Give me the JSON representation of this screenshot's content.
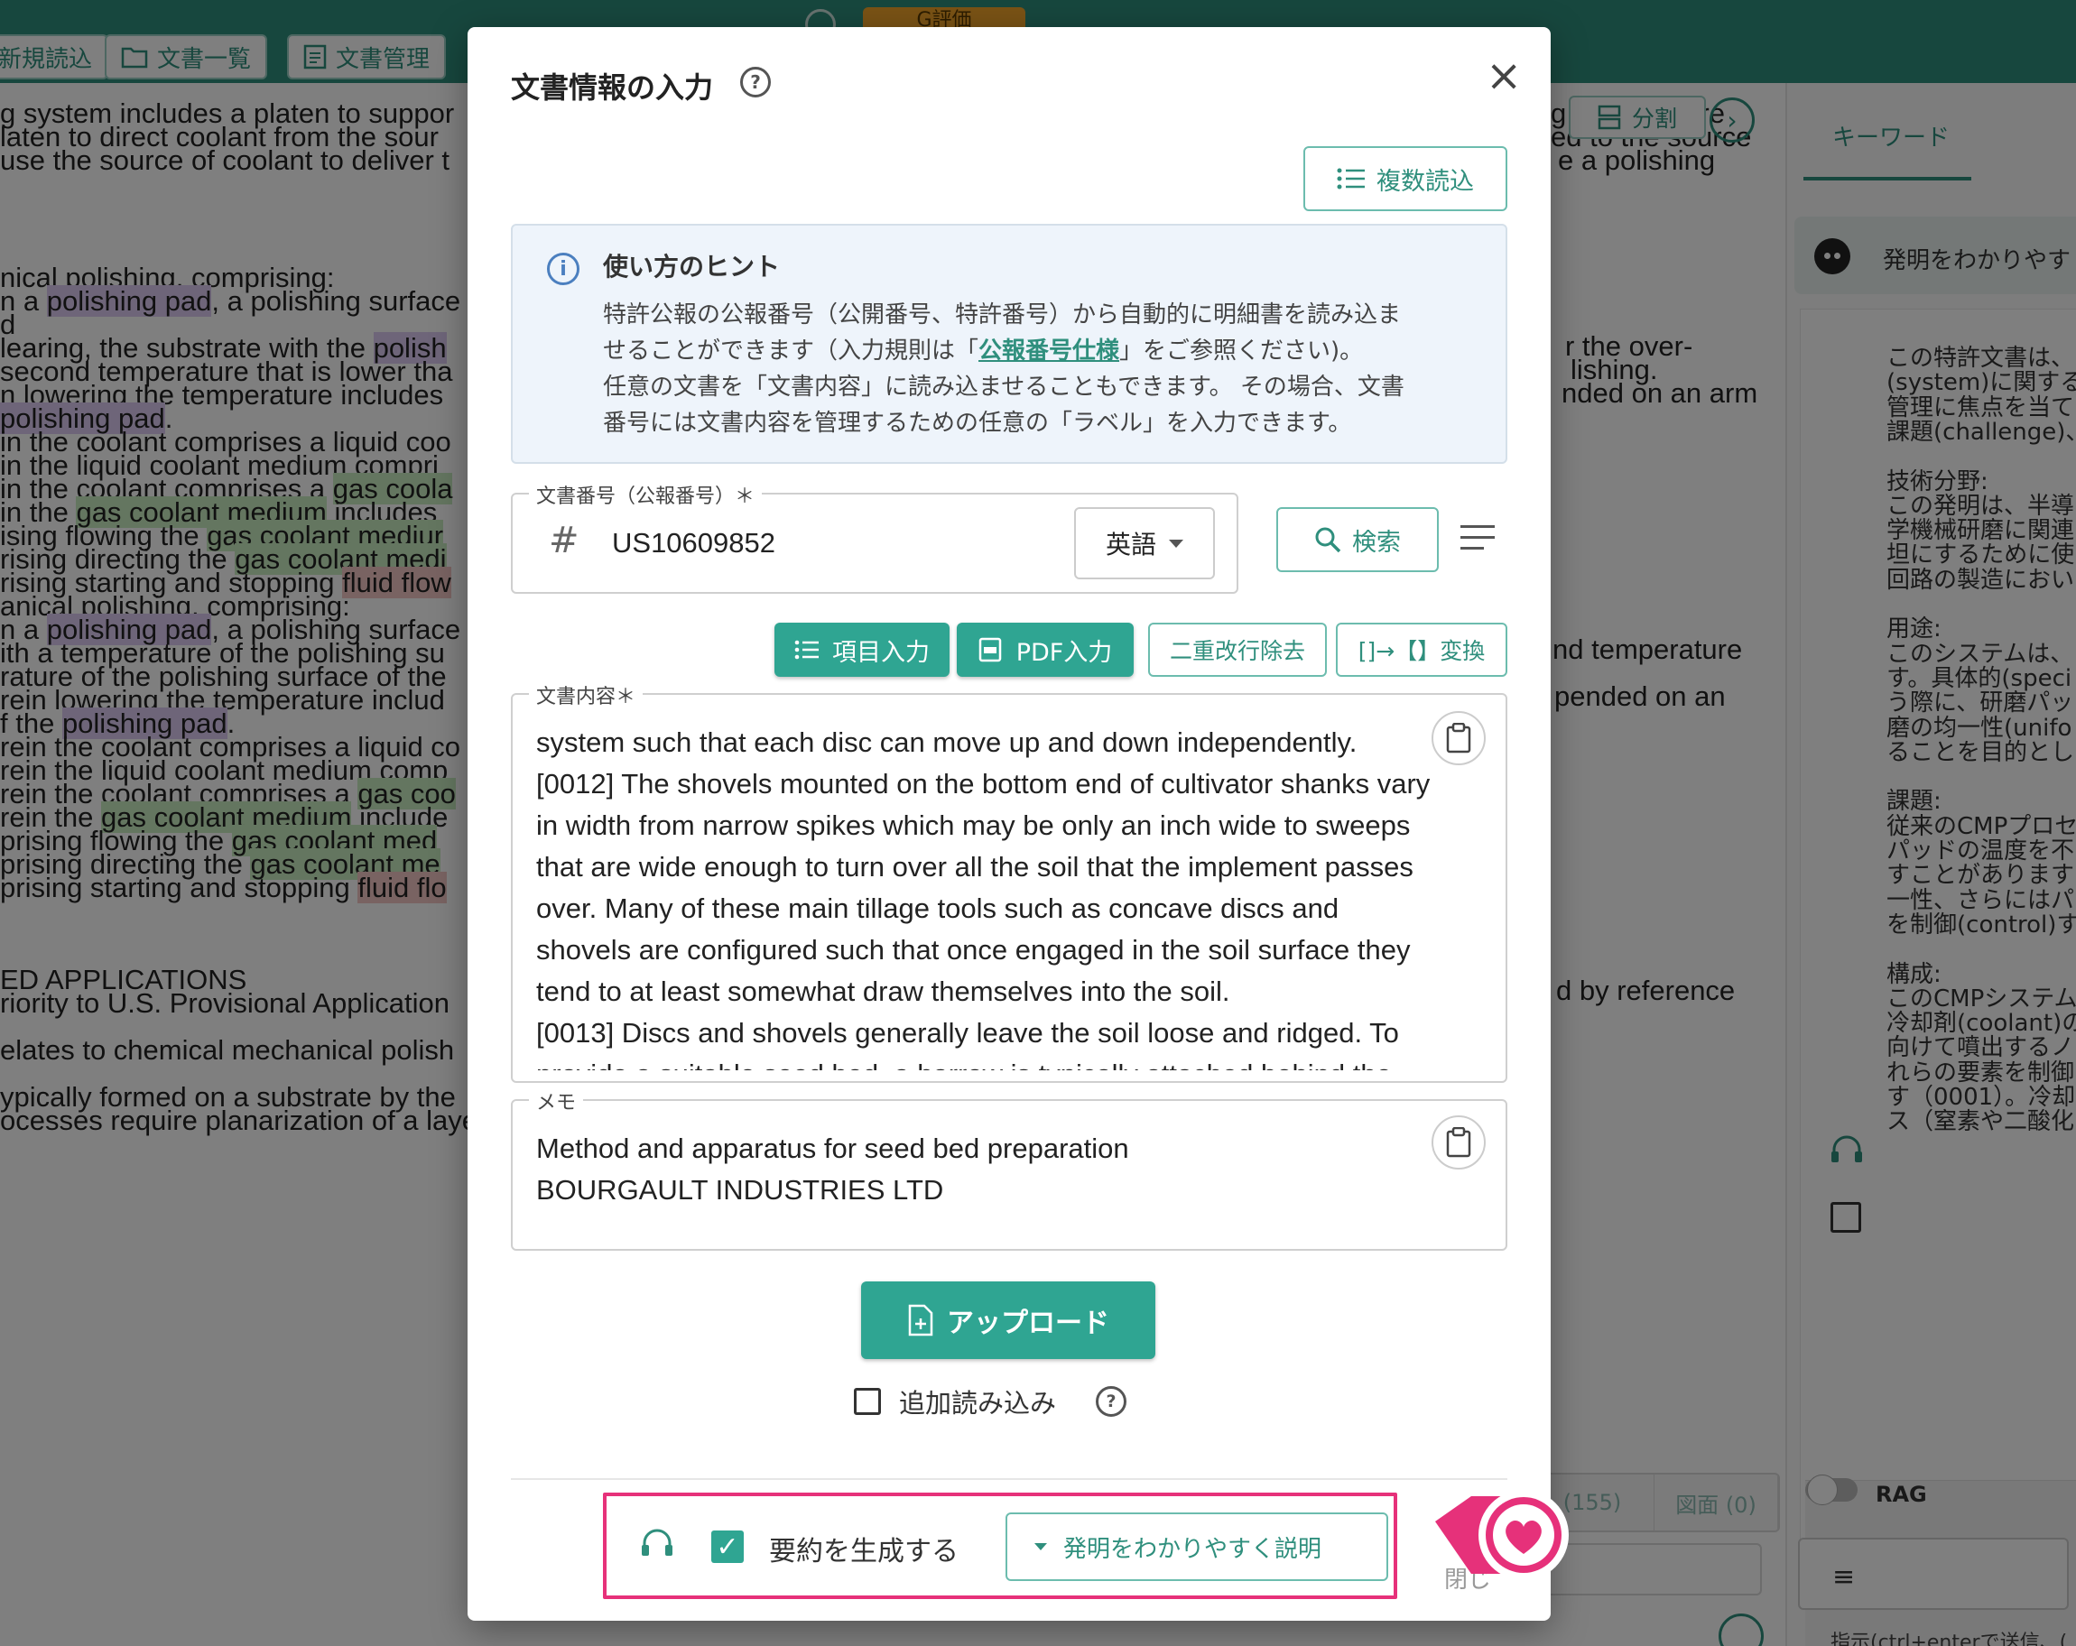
{
  "toolbar": {
    "buttons": [
      {
        "label": "新規読込"
      },
      {
        "label": "文書一覧"
      },
      {
        "label": "文書管理"
      }
    ],
    "pill_label": "G評価",
    "split_label": "分割"
  },
  "doc_left_lines": [
    {
      "parts": [
        {
          "t": "g system includes a platen to suppor"
        }
      ]
    },
    {
      "parts": [
        {
          "t": "laten to direct coolant from the sour"
        }
      ]
    },
    {
      "parts": [
        {
          "t": "use the source of coolant to deliver t"
        }
      ]
    },
    {
      "parts": [
        {
          "t": "nical polishing, comprising:"
        }
      ]
    },
    {
      "parts": [
        {
          "t": "n a "
        },
        {
          "t": "polishing pad",
          "h": "hp"
        },
        {
          "t": ", a polishing surface"
        }
      ]
    },
    {
      "parts": [
        {
          "t": "d"
        }
      ]
    },
    {
      "parts": [
        {
          "t": "learing, the substrate with the "
        },
        {
          "t": "polish",
          "h": "hp"
        }
      ]
    },
    {
      "parts": [
        {
          "t": "second temperature that is lower tha"
        }
      ]
    },
    {
      "parts": [
        {
          "t": "n lowering the temperature includes"
        }
      ]
    },
    {
      "parts": [
        {
          "t": " "
        },
        {
          "t": "polishing pad",
          "h": "hp"
        },
        {
          "t": "."
        }
      ]
    },
    {
      "parts": [
        {
          "t": "in the coolant comprises a liquid coo"
        }
      ]
    },
    {
      "parts": [
        {
          "t": "in the liquid coolant medium compri"
        }
      ]
    },
    {
      "parts": [
        {
          "t": "in the coolant comprises a "
        },
        {
          "t": "gas coola",
          "h": "hg"
        }
      ]
    },
    {
      "parts": [
        {
          "t": "in the "
        },
        {
          "t": "gas coolant medium",
          "h": "hg"
        },
        {
          "t": " includes"
        }
      ]
    },
    {
      "parts": [
        {
          "t": "ising flowing the "
        },
        {
          "t": "gas coolant mediur",
          "h": "hg"
        }
      ]
    },
    {
      "parts": [
        {
          "t": "rising directing the "
        },
        {
          "t": "gas coolant medi",
          "h": "hg"
        }
      ]
    },
    {
      "parts": [
        {
          "t": "rising starting and stopping "
        },
        {
          "t": "fluid flow",
          "h": "hr"
        }
      ]
    },
    {
      "parts": [
        {
          "t": "anical polishing, comprising:"
        }
      ]
    },
    {
      "parts": [
        {
          "t": "n a "
        },
        {
          "t": "polishing pad",
          "h": "hp"
        },
        {
          "t": ", a polishing surface"
        }
      ]
    },
    {
      "parts": [
        {
          "t": "ith a temperature of the polishing su"
        }
      ]
    },
    {
      "parts": [
        {
          "t": "rature of the polishing surface of the"
        }
      ]
    },
    {
      "parts": [
        {
          "t": "rein lowering the temperature includ"
        }
      ]
    },
    {
      "parts": [
        {
          "t": "f the "
        },
        {
          "t": "polishing pad",
          "h": "hp"
        },
        {
          "t": "."
        }
      ]
    },
    {
      "parts": [
        {
          "t": "rein the coolant comprises a liquid co"
        }
      ]
    },
    {
      "parts": [
        {
          "t": "rein the liquid coolant medium comp"
        }
      ]
    },
    {
      "parts": [
        {
          "t": "rein the coolant comprises a "
        },
        {
          "t": "gas coo",
          "h": "hg"
        }
      ]
    },
    {
      "parts": [
        {
          "t": "rein the "
        },
        {
          "t": "gas coolant medium",
          "h": "hg"
        },
        {
          "t": " include"
        }
      ]
    },
    {
      "parts": [
        {
          "t": "prising flowing the "
        },
        {
          "t": "gas coolant med",
          "h": "hg"
        }
      ]
    },
    {
      "parts": [
        {
          "t": "prising directing the "
        },
        {
          "t": "gas coolant me",
          "h": "hg"
        }
      ]
    },
    {
      "parts": [
        {
          "t": "prising starting and stopping "
        },
        {
          "t": "fluid flo",
          "h": "hr"
        }
      ]
    },
    {
      "parts": [
        {
          "t": "ED APPLICATIONS"
        }
      ]
    },
    {
      "parts": [
        {
          "t": "riority to U.S. Provisional Application"
        }
      ]
    },
    {
      "parts": [
        {
          "t": "elates to chemical mechanical polish"
        }
      ]
    },
    {
      "parts": [
        {
          "t": "ypically formed on a substrate by the"
        }
      ]
    },
    {
      "parts": [
        {
          "t": "ocesses require planarization of a layer on the substrate. For example, one fabrication step involves de"
        }
      ]
    }
  ],
  "doc_right_lines": [
    "g one or more",
    "ed to the source",
    "e a polishing",
    "r the over-",
    "lishing.",
    "nded on an arm",
    "nd temperature",
    "pended on an",
    "d by reference"
  ],
  "right_panel": {
    "tab": "キーワード",
    "card_text": "発明をわかりやす",
    "lines": [
      "この特許文書は、",
      "(system)に関する",
      "管理に焦点を当て",
      "課題(challenge)、",
      "",
      "技術分野:",
      "この発明は、半導",
      "学機械研磨に関連",
      "坦にするために使",
      "回路の製造におい",
      "",
      "用途:",
      "このシステムは、",
      "す。具体的(speci",
      "う際に、研磨パッ",
      "磨の均一性(unifo",
      "ることを目的とし",
      "",
      "課題:",
      "従来のCMPプロセ",
      "パッドの温度を不",
      "すことがあります",
      "一性、さらにはパ",
      "を制御(control)す",
      "",
      "構成:",
      "このCMPシステム",
      "冷却剤(coolant)の",
      "向けて噴出するノ",
      "れらの要素を制御",
      "す（0001）。冷却",
      "ス（窒素や二酸化"
    ],
    "rag_label": "RAG",
    "hint": "指示(ctrl+enterで送信、("
  },
  "under_tabs": [
    {
      "label": "(155)"
    },
    {
      "label": "図面 (0)"
    }
  ],
  "modal": {
    "title": "文書情報の入力",
    "multi_load_label": "複数読込",
    "hint_title": "使い方のヒント",
    "hint_line1": "特許公報の公報番号（公開番号、特許番号）から自動的に明細書を読み込ま",
    "hint_line2_pre": "せることができます（入力規則は「",
    "hint_link": "公報番号仕様",
    "hint_line2_post": "」をご参照ください)。",
    "hint_line3": "任意の文書を「文書内容」に読み込ませることもできます。 その場合、文書",
    "hint_line4": "番号には文書内容を管理するための任意の「ラベル」を入力できます。",
    "docno_legend": "文書番号（公報番号）＊",
    "docno_value": "US10609852",
    "lang_value": "英語",
    "search_label": "検索",
    "item_input_label": "項目入力",
    "pdf_input_label": "PDF入力",
    "remove_newline_label": "二重改行除去",
    "convert_label": "[]→【】変換",
    "content_legend": "文書内容＊",
    "content_lines": [
      "system such that each disc can move up and down independently.",
      "[0012] The shovels mounted on the bottom end of cultivator shanks vary",
      "in width from narrow spikes which may be only an inch wide to sweeps",
      "that are wide enough to turn over all the soil that the implement passes",
      "over. Many of these main tillage tools such as concave discs and",
      "shovels are configured such that once engaged in the soil surface they",
      "tend to at least somewhat draw themselves into the soil.",
      "[0013] Discs and shovels generally leave the soil loose and ridged. To",
      "provide a suitable seed bed, a harrow is typically attached behind the"
    ],
    "memo_legend": "メモ",
    "memo_lines": [
      "Method and apparatus for seed bed preparation",
      "BOURGAULT INDUSTRIES LTD"
    ],
    "upload_label": "アップロード",
    "additional_load_label": "追加読み込み",
    "generate_summary_label": "要約を生成する",
    "summary_style_label": "発明をわかりやすく説明",
    "close_label": "閉じ"
  },
  "colors": {
    "accent": "#2fa592",
    "highlight_border": "#e6317a"
  }
}
